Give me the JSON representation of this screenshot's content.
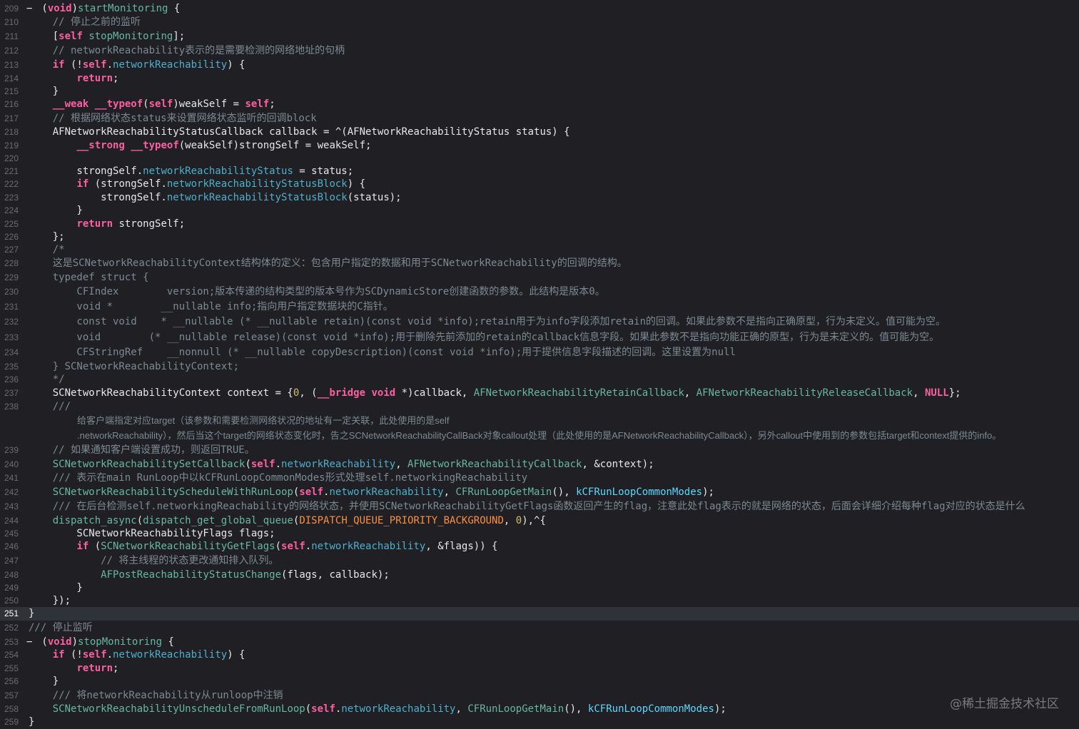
{
  "editor": {
    "watermark": "@稀土掘金技术社区",
    "current_line": "251",
    "colors": {
      "background": "#1f1f24",
      "current_line_bg": "#2f3239",
      "keyword": "#fc5fa3",
      "comment": "#7d8a94",
      "type": "#5dd8ff",
      "function": "#67b7a4",
      "property": "#4eb0cc",
      "number": "#d0bf69",
      "macro": "#fd8f3f",
      "plain": "#e8e8e8"
    },
    "lines": [
      {
        "n": "209",
        "fold": "−",
        "segs": [
          [
            "txt",
            " ("
          ],
          [
            "kw",
            "void"
          ],
          [
            "txt",
            ")"
          ],
          [
            "fn",
            "startMonitoring"
          ],
          [
            "txt",
            " {"
          ]
        ]
      },
      {
        "n": "210",
        "segs": [
          [
            "cm",
            "    // 停止之前的监听"
          ]
        ]
      },
      {
        "n": "211",
        "segs": [
          [
            "txt",
            "    ["
          ],
          [
            "kw",
            "self"
          ],
          [
            "txt",
            " "
          ],
          [
            "fn",
            "stopMonitoring"
          ],
          [
            "txt",
            "];"
          ]
        ]
      },
      {
        "n": "212",
        "segs": [
          [
            "cm",
            "    // networkReachability表示的是需要检测的网络地址的句柄"
          ]
        ]
      },
      {
        "n": "213",
        "segs": [
          [
            "txt",
            "    "
          ],
          [
            "kw",
            "if"
          ],
          [
            "txt",
            " (!"
          ],
          [
            "kw",
            "self"
          ],
          [
            "txt",
            "."
          ],
          [
            "prop",
            "networkReachability"
          ],
          [
            "txt",
            ") {"
          ]
        ]
      },
      {
        "n": "214",
        "segs": [
          [
            "txt",
            "        "
          ],
          [
            "kw",
            "return"
          ],
          [
            "txt",
            ";"
          ]
        ]
      },
      {
        "n": "215",
        "segs": [
          [
            "txt",
            "    }"
          ]
        ]
      },
      {
        "n": "216",
        "segs": [
          [
            "txt",
            "    "
          ],
          [
            "kw",
            "__weak"
          ],
          [
            "txt",
            " "
          ],
          [
            "kw",
            "__typeof"
          ],
          [
            "txt",
            "("
          ],
          [
            "kw",
            "self"
          ],
          [
            "txt",
            ")weakSelf = "
          ],
          [
            "kw",
            "self"
          ],
          [
            "txt",
            ";"
          ]
        ]
      },
      {
        "n": "217",
        "segs": [
          [
            "cm",
            "    // 根据网络状态status来设置网络状态监听的回调block"
          ]
        ]
      },
      {
        "n": "218",
        "segs": [
          [
            "txt",
            "    AFNetworkReachabilityStatusCallback callback = ^(AFNetworkReachabilityStatus status) {"
          ]
        ]
      },
      {
        "n": "219",
        "segs": [
          [
            "txt",
            "        "
          ],
          [
            "kw",
            "__strong"
          ],
          [
            "txt",
            " "
          ],
          [
            "kw",
            "__typeof"
          ],
          [
            "txt",
            "(weakSelf)strongSelf = weakSelf;"
          ]
        ]
      },
      {
        "n": "220",
        "segs": []
      },
      {
        "n": "221",
        "segs": [
          [
            "txt",
            "        strongSelf."
          ],
          [
            "prop",
            "networkReachabilityStatus"
          ],
          [
            "txt",
            " = status;"
          ]
        ]
      },
      {
        "n": "222",
        "segs": [
          [
            "txt",
            "        "
          ],
          [
            "kw",
            "if"
          ],
          [
            "txt",
            " (strongSelf."
          ],
          [
            "prop",
            "networkReachabilityStatusBlock"
          ],
          [
            "txt",
            ") {"
          ]
        ]
      },
      {
        "n": "223",
        "segs": [
          [
            "txt",
            "            strongSelf."
          ],
          [
            "prop",
            "networkReachabilityStatusBlock"
          ],
          [
            "txt",
            "(status);"
          ]
        ]
      },
      {
        "n": "224",
        "segs": [
          [
            "txt",
            "        }"
          ]
        ]
      },
      {
        "n": "225",
        "segs": [
          [
            "txt",
            "        "
          ],
          [
            "kw",
            "return"
          ],
          [
            "txt",
            " strongSelf;"
          ]
        ]
      },
      {
        "n": "226",
        "segs": [
          [
            "txt",
            "    };"
          ]
        ]
      },
      {
        "n": "227",
        "segs": [
          [
            "cm",
            "    /*"
          ]
        ]
      },
      {
        "n": "228",
        "segs": [
          [
            "cm",
            "    这是SCNetworkReachabilityContext结构体的定义：包含用户指定的数据和用于SCNetworkReachability的回调的结构。"
          ]
        ]
      },
      {
        "n": "229",
        "segs": [
          [
            "cm",
            "    typedef struct {"
          ]
        ]
      },
      {
        "n": "230",
        "segs": [
          [
            "cm",
            "        CFIndex        version;版本传递的结构类型的版本号作为SCDynamicStore创建函数的参数。此结构是版本0。"
          ]
        ]
      },
      {
        "n": "231",
        "segs": [
          [
            "cm",
            "        void *        __nullable info;指向用户指定数据块的C指针。"
          ]
        ]
      },
      {
        "n": "232",
        "segs": [
          [
            "cm",
            "        const void    * __nullable (* __nullable retain)(const void *info);retain用于为info字段添加retain的回调。如果此参数不是指向正确原型，行为未定义。值可能为空。"
          ]
        ]
      },
      {
        "n": "233",
        "segs": [
          [
            "cm",
            "        void        (* __nullable release)(const void *info);用于删除先前添加的retain的callback信息字段。如果此参数不是指向功能正确的原型，行为是未定义的。值可能为空。"
          ]
        ]
      },
      {
        "n": "234",
        "segs": [
          [
            "cm",
            "        CFStringRef    __nonnull (* __nullable copyDescription)(const void *info);用于提供信息字段描述的回调。这里设置为null"
          ]
        ]
      },
      {
        "n": "235",
        "segs": [
          [
            "cm",
            "    } SCNetworkReachabilityContext;"
          ]
        ]
      },
      {
        "n": "236",
        "segs": [
          [
            "cm",
            "    */"
          ]
        ]
      },
      {
        "n": "237",
        "segs": [
          [
            "txt",
            "    SCNetworkReachabilityContext context = {"
          ],
          [
            "num",
            "0"
          ],
          [
            "txt",
            ", ("
          ],
          [
            "kw",
            "__bridge"
          ],
          [
            "txt",
            " "
          ],
          [
            "kw",
            "void"
          ],
          [
            "txt",
            " *)callback, "
          ],
          [
            "fn",
            "AFNetworkReachabilityRetainCallback"
          ],
          [
            "txt",
            ", "
          ],
          [
            "fn",
            "AFNetworkReachabilityReleaseCallback"
          ],
          [
            "txt",
            ", "
          ],
          [
            "kw",
            "NULL"
          ],
          [
            "txt",
            "};"
          ]
        ]
      },
      {
        "n": "238",
        "segs": [
          [
            "cm",
            "    ///"
          ]
        ]
      },
      {
        "n": "",
        "doc": true,
        "segs": [
          [
            "cm",
            "给客户端指定对应target（该参数和需要检测网络状况的地址有一定关联，此处使用的是self"
          ]
        ]
      },
      {
        "n": "",
        "doc": true,
        "segs": [
          [
            "cm",
            ".networkReachability），然后当这个target的网络状态变化时，告之SCNetworkReachabilityCallBack对象callout处理（此处使用的是AFNetworkReachabilityCallback），另外callout中使用到的参数包括target和context提供的info。"
          ]
        ]
      },
      {
        "n": "239",
        "segs": [
          [
            "cm",
            "    // 如果通知客户端设置成功，则返回TRUE。"
          ]
        ]
      },
      {
        "n": "240",
        "segs": [
          [
            "txt",
            "    "
          ],
          [
            "fn",
            "SCNetworkReachabilitySetCallback"
          ],
          [
            "txt",
            "("
          ],
          [
            "kw",
            "self"
          ],
          [
            "txt",
            "."
          ],
          [
            "prop",
            "networkReachability"
          ],
          [
            "txt",
            ", "
          ],
          [
            "fn",
            "AFNetworkReachabilityCallback"
          ],
          [
            "txt",
            ", &context);"
          ]
        ]
      },
      {
        "n": "241",
        "segs": [
          [
            "cm",
            "    /// 表示在main RunLoop中以kCFRunLoopCommonModes形式处理self.networkingReachability"
          ]
        ]
      },
      {
        "n": "242",
        "segs": [
          [
            "txt",
            "    "
          ],
          [
            "fn",
            "SCNetworkReachabilityScheduleWithRunLoop"
          ],
          [
            "txt",
            "("
          ],
          [
            "kw",
            "self"
          ],
          [
            "txt",
            "."
          ],
          [
            "prop",
            "networkReachability"
          ],
          [
            "txt",
            ", "
          ],
          [
            "fn",
            "CFRunLoopGetMain"
          ],
          [
            "txt",
            "(), "
          ],
          [
            "cls",
            "kCFRunLoopCommonModes"
          ],
          [
            "txt",
            ");"
          ]
        ]
      },
      {
        "n": "243",
        "segs": [
          [
            "cm",
            "    /// 在后台检测self.networkingReachability的网络状态，并使用SCNetworkReachabilityGetFlags函数返回产生的flag，注意此处flag表示的就是网络的状态，后面会详细介绍每种flag对应的状态是什么"
          ]
        ]
      },
      {
        "n": "244",
        "segs": [
          [
            "txt",
            "    "
          ],
          [
            "fn",
            "dispatch_async"
          ],
          [
            "txt",
            "("
          ],
          [
            "fn",
            "dispatch_get_global_queue"
          ],
          [
            "txt",
            "("
          ],
          [
            "mac",
            "DISPATCH_QUEUE_PRIORITY_BACKGROUND"
          ],
          [
            "txt",
            ", "
          ],
          [
            "num",
            "0"
          ],
          [
            "txt",
            "),^{"
          ]
        ]
      },
      {
        "n": "245",
        "segs": [
          [
            "txt",
            "        SCNetworkReachabilityFlags flags;"
          ]
        ]
      },
      {
        "n": "246",
        "segs": [
          [
            "txt",
            "        "
          ],
          [
            "kw",
            "if"
          ],
          [
            "txt",
            " ("
          ],
          [
            "fn",
            "SCNetworkReachabilityGetFlags"
          ],
          [
            "txt",
            "("
          ],
          [
            "kw",
            "self"
          ],
          [
            "txt",
            "."
          ],
          [
            "prop",
            "networkReachability"
          ],
          [
            "txt",
            ", &flags)) {"
          ]
        ]
      },
      {
        "n": "247",
        "segs": [
          [
            "cm",
            "            // 将主线程的状态更改通知排入队列。"
          ]
        ]
      },
      {
        "n": "248",
        "segs": [
          [
            "txt",
            "            "
          ],
          [
            "fn",
            "AFPostReachabilityStatusChange"
          ],
          [
            "txt",
            "(flags, callback);"
          ]
        ]
      },
      {
        "n": "249",
        "segs": [
          [
            "txt",
            "        }"
          ]
        ]
      },
      {
        "n": "250",
        "segs": [
          [
            "txt",
            "    });"
          ]
        ]
      },
      {
        "n": "251",
        "current": true,
        "segs": [
          [
            "txt",
            "}"
          ]
        ]
      },
      {
        "n": "252",
        "segs": [
          [
            "cm",
            "/// 停止监听"
          ]
        ]
      },
      {
        "n": "253",
        "fold": "−",
        "segs": [
          [
            "txt",
            " ("
          ],
          [
            "kw",
            "void"
          ],
          [
            "txt",
            ")"
          ],
          [
            "fn",
            "stopMonitoring"
          ],
          [
            "txt",
            " {"
          ]
        ]
      },
      {
        "n": "254",
        "segs": [
          [
            "txt",
            "    "
          ],
          [
            "kw",
            "if"
          ],
          [
            "txt",
            " (!"
          ],
          [
            "kw",
            "self"
          ],
          [
            "txt",
            "."
          ],
          [
            "prop",
            "networkReachability"
          ],
          [
            "txt",
            ") {"
          ]
        ]
      },
      {
        "n": "255",
        "segs": [
          [
            "txt",
            "        "
          ],
          [
            "kw",
            "return"
          ],
          [
            "txt",
            ";"
          ]
        ]
      },
      {
        "n": "256",
        "segs": [
          [
            "txt",
            "    }"
          ]
        ]
      },
      {
        "n": "257",
        "segs": [
          [
            "cm",
            "    /// 将networkReachability从runloop中注销"
          ]
        ]
      },
      {
        "n": "258",
        "segs": [
          [
            "txt",
            "    "
          ],
          [
            "fn",
            "SCNetworkReachabilityUnscheduleFromRunLoop"
          ],
          [
            "txt",
            "("
          ],
          [
            "kw",
            "self"
          ],
          [
            "txt",
            "."
          ],
          [
            "prop",
            "networkReachability"
          ],
          [
            "txt",
            ", "
          ],
          [
            "fn",
            "CFRunLoopGetMain"
          ],
          [
            "txt",
            "(), "
          ],
          [
            "cls",
            "kCFRunLoopCommonModes"
          ],
          [
            "txt",
            ");"
          ]
        ]
      },
      {
        "n": "259",
        "segs": [
          [
            "txt",
            "}"
          ]
        ]
      }
    ]
  }
}
